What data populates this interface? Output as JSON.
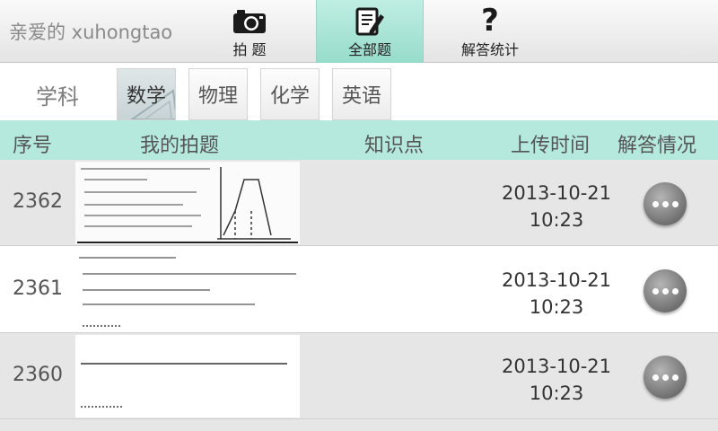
{
  "header": {
    "greeting": "亲爱的 xuhongtao",
    "nav": [
      {
        "label": "拍 题",
        "icon": "camera-icon"
      },
      {
        "label": "全部题",
        "icon": "edit-note-icon",
        "active": true
      },
      {
        "label": "解答统计",
        "icon": "question-icon"
      }
    ]
  },
  "subjects": {
    "label": "学科",
    "tabs": [
      "数学",
      "物理",
      "化学",
      "英语"
    ],
    "active_index": 0
  },
  "table": {
    "columns": [
      "序号",
      "我的拍题",
      "知识点",
      "上传时间",
      "解答情况"
    ],
    "rows": [
      {
        "id": "2362",
        "knowledge": "",
        "date": "2013-10-21",
        "time": "10:23",
        "action_icon": "more-icon"
      },
      {
        "id": "2361",
        "knowledge": "",
        "date": "2013-10-21",
        "time": "10:23",
        "action_icon": "more-icon"
      },
      {
        "id": "2360",
        "knowledge": "",
        "date": "2013-10-21",
        "time": "10:23",
        "action_icon": "more-icon"
      }
    ]
  },
  "colors": {
    "accent": "#b6e9de",
    "active_nav": "#a8e3d4",
    "row_alt": "#e6e6e6"
  }
}
